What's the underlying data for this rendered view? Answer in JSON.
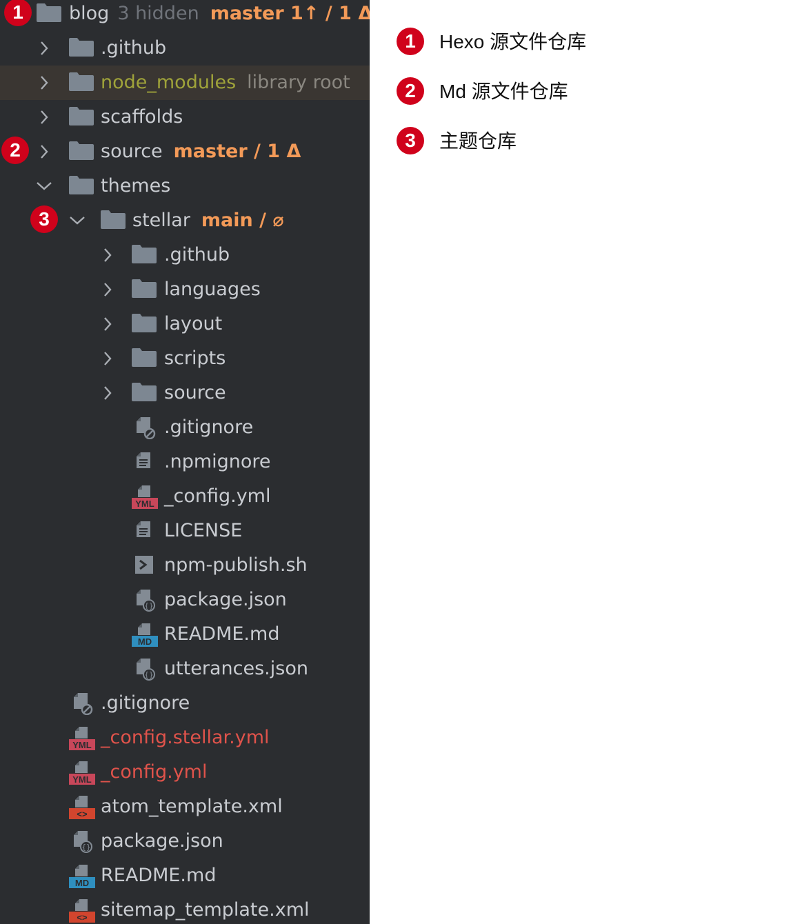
{
  "tree": {
    "rows": [
      {
        "label": "blog",
        "hint": "3 hidden",
        "branch": "master 1↑ / 1 Δ",
        "type": "folder",
        "expanded": true,
        "marker": "1"
      },
      {
        "label": ".github",
        "type": "folder",
        "expanded": false
      },
      {
        "label": "node_modules",
        "hint": "library root",
        "type": "folder",
        "expanded": false,
        "library": true
      },
      {
        "label": "scaffolds",
        "type": "folder",
        "expanded": false
      },
      {
        "label": "source",
        "branch": "master / 1 Δ",
        "type": "folder",
        "expanded": false,
        "marker": "2"
      },
      {
        "label": "themes",
        "type": "folder",
        "expanded": true
      },
      {
        "label": "stellar",
        "branch": "main / ⌀",
        "type": "folder",
        "expanded": true,
        "marker": "3"
      },
      {
        "label": ".github",
        "type": "folder",
        "expanded": false
      },
      {
        "label": "languages",
        "type": "folder",
        "expanded": false
      },
      {
        "label": "layout",
        "type": "folder",
        "expanded": false
      },
      {
        "label": "scripts",
        "type": "folder",
        "expanded": false
      },
      {
        "label": "source",
        "type": "folder",
        "expanded": false
      },
      {
        "label": ".gitignore",
        "type": "ignore-file"
      },
      {
        "label": ".npmignore",
        "type": "text-file"
      },
      {
        "label": "_config.yml",
        "type": "yml-file"
      },
      {
        "label": "LICENSE",
        "type": "text-file"
      },
      {
        "label": "npm-publish.sh",
        "type": "shell-file"
      },
      {
        "label": "package.json",
        "type": "json-file"
      },
      {
        "label": "README.md",
        "type": "md-file"
      },
      {
        "label": "utterances.json",
        "type": "json-file"
      },
      {
        "label": ".gitignore",
        "type": "ignore-file"
      },
      {
        "label": "_config.stellar.yml",
        "type": "yml-file",
        "status": "modified"
      },
      {
        "label": "_config.yml",
        "type": "yml-file",
        "status": "modified"
      },
      {
        "label": "atom_template.xml",
        "type": "xml-file"
      },
      {
        "label": "package.json",
        "type": "json-file"
      },
      {
        "label": "README.md",
        "type": "md-file"
      },
      {
        "label": "sitemap_template.xml",
        "type": "xml-file"
      }
    ]
  },
  "legend": {
    "items": [
      {
        "marker": "1",
        "text": "Hexo 源文件仓库"
      },
      {
        "marker": "2",
        "text": "Md 源文件仓库"
      },
      {
        "marker": "3",
        "text": "主题仓库"
      }
    ]
  },
  "colors": {
    "panel_bg": "#2b2d30",
    "text": "#c9ccd1",
    "branch": "#f39a58",
    "modified": "#e0534b",
    "library": "#9fa33a",
    "marker": "#d0021b"
  }
}
